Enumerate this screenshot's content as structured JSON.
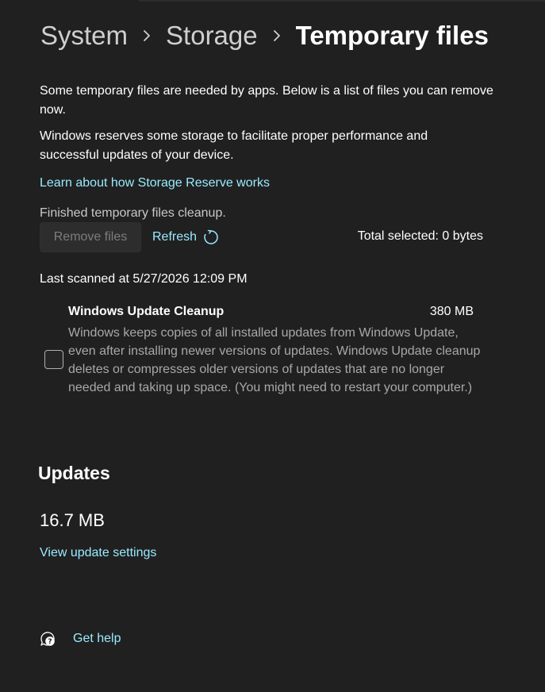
{
  "breadcrumb": {
    "items": [
      "System",
      "Storage"
    ],
    "current": "Temporary files"
  },
  "intro": {
    "line1": "Some temporary files are needed by apps. Below is a list of files you can remove now.",
    "line2": "Windows reserves some storage to facilitate proper performance and successful updates of your device.",
    "learn_link": "Learn about how Storage Reserve works"
  },
  "status": {
    "cleanup_text": "Finished temporary files cleanup.",
    "remove_label": "Remove files",
    "refresh_label": "Refresh",
    "total_selected": "Total selected: 0 bytes",
    "last_scanned": "Last scanned at 5/27/2026 12:09 PM"
  },
  "items": [
    {
      "title": "Windows Update Cleanup",
      "size": "380 MB",
      "description": "Windows keeps copies of all installed updates from Windows Update, even after installing newer versions of updates. Windows Update cleanup deletes or compresses older versions of updates that are no longer needed and taking up space. (You might need to restart your computer.)",
      "checked": false
    }
  ],
  "updates": {
    "heading": "Updates",
    "size": "16.7 MB",
    "link": "View update settings"
  },
  "help": {
    "label": "Get help",
    "icon": "help-chat-icon"
  },
  "colors": {
    "background": "#202020",
    "link": "#99ebff",
    "secondary_text": "#a8a8a8"
  }
}
